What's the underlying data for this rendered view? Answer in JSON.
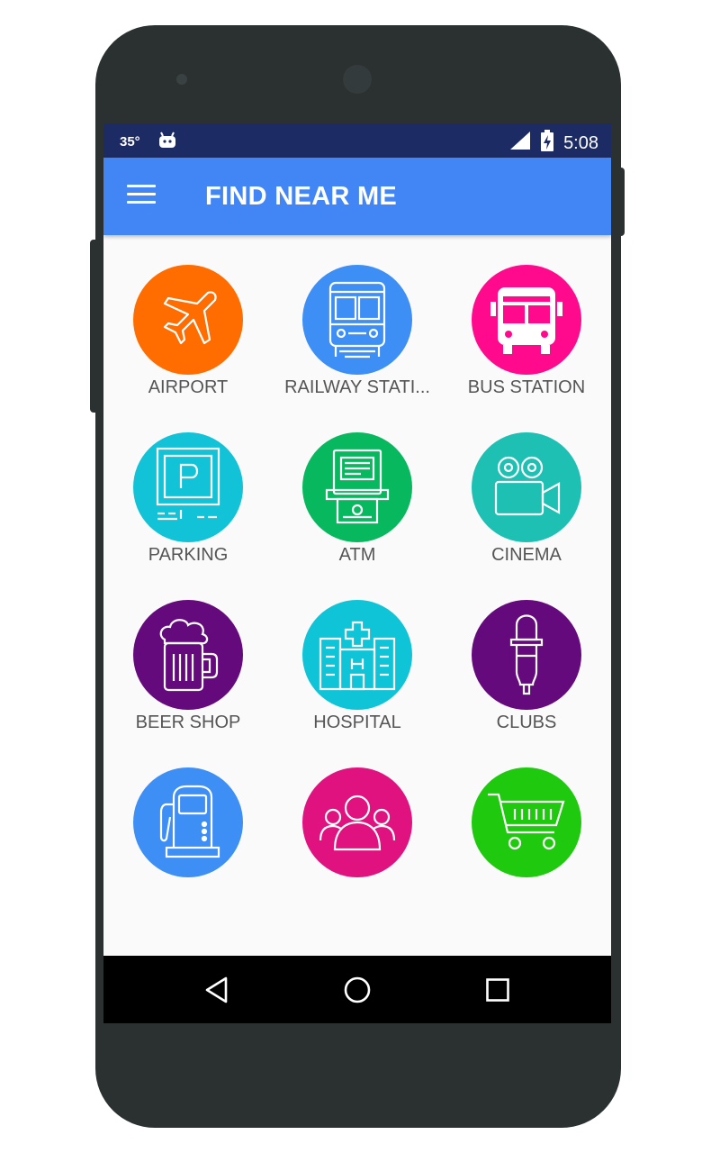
{
  "status_bar": {
    "temperature": "35°",
    "time": "5:08",
    "notification_icon": "android-icon",
    "signal_icon": "signal-icon",
    "battery_icon": "battery-charging-icon"
  },
  "app_bar": {
    "title": "FIND NEAR ME",
    "menu_icon": "hamburger-menu-icon"
  },
  "categories": [
    {
      "label": "AIRPORT",
      "icon": "airplane-icon",
      "color": "#ff6d00"
    },
    {
      "label": "RAILWAY STATI...",
      "icon": "train-icon",
      "color": "#3d8ff5"
    },
    {
      "label": "BUS STATION",
      "icon": "bus-icon",
      "color": "#ff0a8c"
    },
    {
      "label": "PARKING",
      "icon": "parking-icon",
      "color": "#12c3d8"
    },
    {
      "label": "ATM",
      "icon": "atm-icon",
      "color": "#08b85e"
    },
    {
      "label": "CINEMA",
      "icon": "movie-camera-icon",
      "color": "#1ec0b3"
    },
    {
      "label": "BEER SHOP",
      "icon": "beer-mug-icon",
      "color": "#650a7d"
    },
    {
      "label": "HOSPITAL",
      "icon": "hospital-icon",
      "color": "#10c4d8"
    },
    {
      "label": "CLUBS",
      "icon": "microphone-icon",
      "color": "#650a7d"
    },
    {
      "label": "",
      "icon": "fuel-pump-icon",
      "color": "#3d8ff5"
    },
    {
      "label": "",
      "icon": "people-icon",
      "color": "#e0127f"
    },
    {
      "label": "",
      "icon": "shopping-cart-icon",
      "color": "#1ec90e"
    }
  ],
  "nav_bar": {
    "back_icon": "back-triangle-icon",
    "home_icon": "home-circle-icon",
    "recents_icon": "recents-square-icon"
  },
  "colors": {
    "status_bar": "#1c2b63",
    "app_bar": "#4285f4",
    "background": "#fafafa",
    "nav_bar": "#000000",
    "label_text": "#555555"
  }
}
